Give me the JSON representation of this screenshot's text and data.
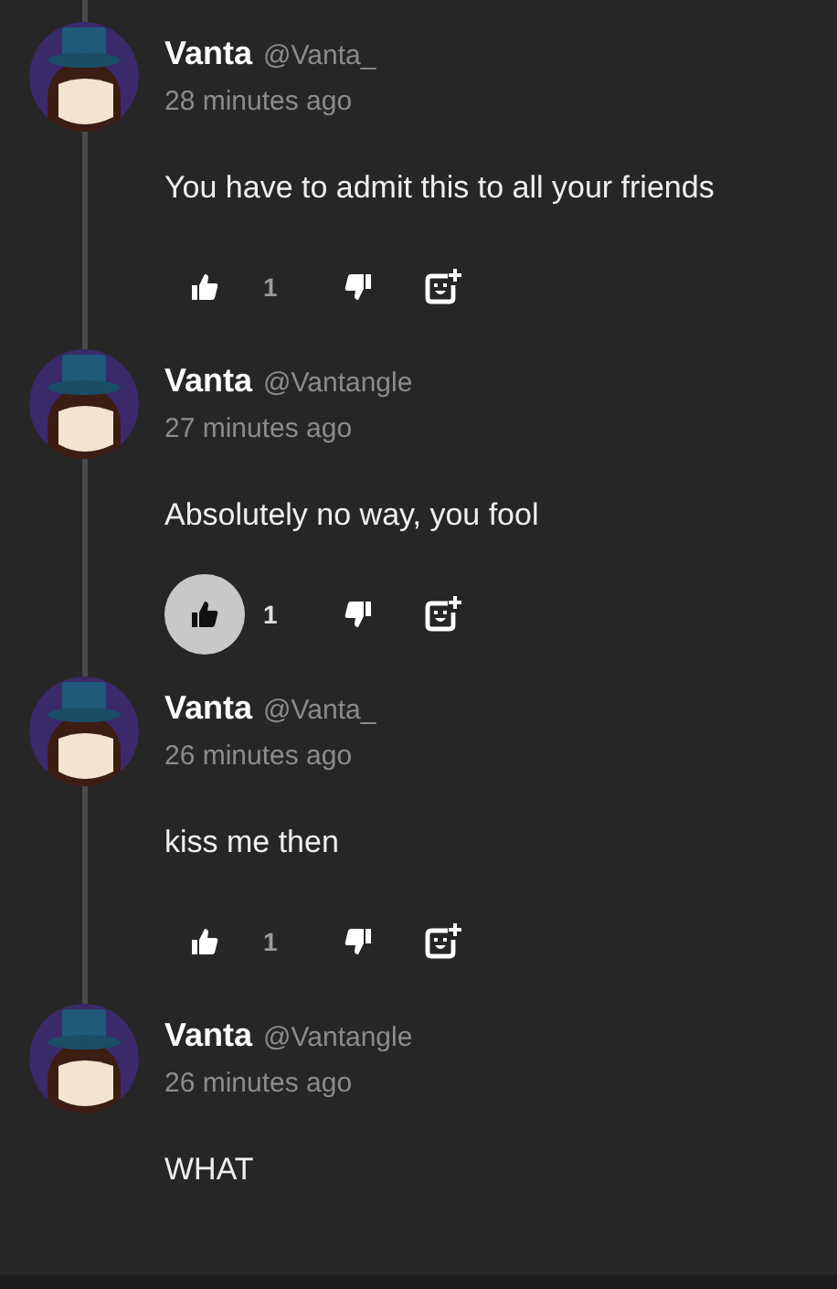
{
  "comments": [
    {
      "name": "Vanta",
      "handle": "@Vanta_",
      "time": "28 minutes ago",
      "text": "You have to admit this to all your friends",
      "likes": "1",
      "liked": false
    },
    {
      "name": "Vanta",
      "handle": "@Vantangle",
      "time": "27 minutes ago",
      "text": "Absolutely no way, you fool",
      "likes": "1",
      "liked": true
    },
    {
      "name": "Vanta",
      "handle": "@Vanta_",
      "time": "26 minutes ago",
      "text": "kiss me then",
      "likes": "1",
      "liked": false
    },
    {
      "name": "Vanta",
      "handle": "@Vantangle",
      "time": "26 minutes ago",
      "text": "WHAT"
    }
  ]
}
